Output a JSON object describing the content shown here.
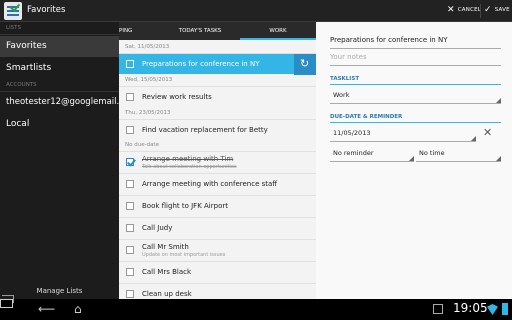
{
  "actionbar": {
    "title": "Favorites",
    "cancel_label": "CANCEL",
    "save_label": "SAVE",
    "cancel_glyph": "✕",
    "save_glyph": "✓"
  },
  "sidebar": {
    "lists_header": "LISTS",
    "items": [
      {
        "label": "Favorites",
        "selected": true
      },
      {
        "label": "Smartlists"
      }
    ],
    "accounts_header": "ACCOUNTS",
    "account": "theotester12@googlemail....",
    "local": "Local",
    "manage_lists": "Manage Lists"
  },
  "tabs": [
    "PING",
    "TODAY'S TASKS",
    "WORK"
  ],
  "tasks": {
    "groups": [
      {
        "date": "Sat, 11/05/2013",
        "items": [
          {
            "title": "Preparations for conference in NY",
            "selected": true
          }
        ]
      },
      {
        "date": "Wed, 15/05/2013",
        "items": [
          {
            "title": "Review work results"
          }
        ]
      },
      {
        "date": "Thu, 23/05/2013",
        "items": [
          {
            "title": "Find vacation replacement for Betty"
          }
        ]
      },
      {
        "date": "No due-date",
        "items": [
          {
            "title": "Arrange meeting with Tim",
            "note": "Talk about collaboration opportunities",
            "done": true
          },
          {
            "title": "Arrange meeting with conference staff"
          },
          {
            "title": "Book flight to JFK Airport"
          },
          {
            "title": "Call Judy"
          },
          {
            "title": "Call Mr Smith",
            "note": "Update on most important issues"
          },
          {
            "title": "Call Mrs Black"
          },
          {
            "title": "Clean up desk"
          }
        ]
      }
    ]
  },
  "detail": {
    "title": "Preparations for conference in NY",
    "notes_placeholder": "Your notes",
    "tasklist_header": "TASKLIST",
    "tasklist_value": "Work",
    "due_header": "DUE-DATE & REMINDER",
    "due_date": "11/05/2013",
    "reminder": "No reminder",
    "time": "No time",
    "clear_glyph": "✕"
  },
  "systembar": {
    "back_glyph": "⟵",
    "home_glyph": "⌂",
    "clock": "19:05"
  }
}
